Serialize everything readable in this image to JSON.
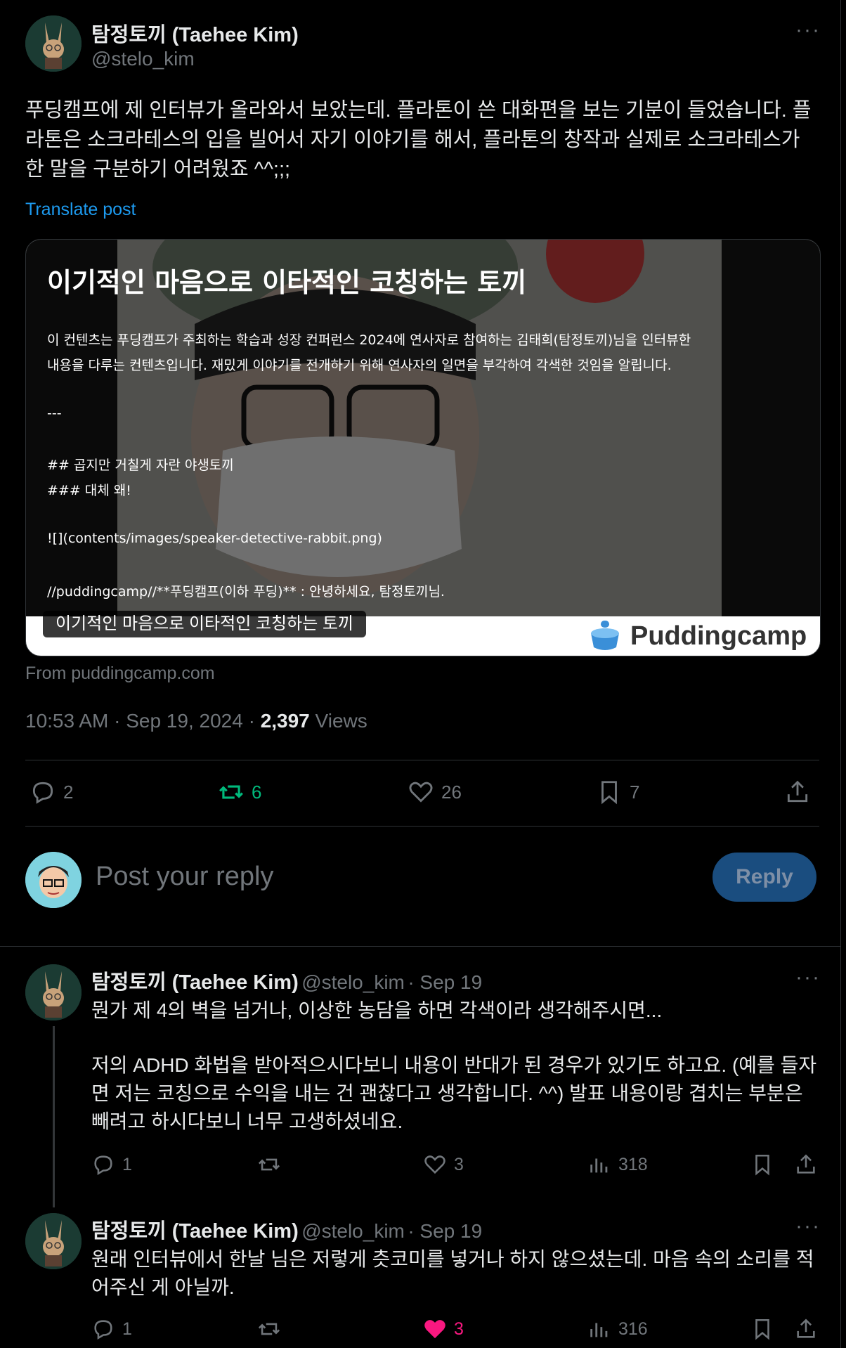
{
  "main_post": {
    "author_name": "탐정토끼 (Taehee Kim)",
    "author_handle": "@stelo_kim",
    "text": "푸딩캠프에 제 인터뷰가 올라와서 보았는데. 플라톤이 쓴 대화편을 보는 기분이 들었습니다. 플라톤은 소크라테스의 입을 빌어서 자기 이야기를 해서, 플라톤의 창작과 실제로 소크라테스가 한 말을 구분하기 어려웠죠 ^^;;;",
    "translate_label": "Translate post",
    "card": {
      "title": "이기적인 마음으로 이타적인 코칭하는 토끼",
      "body_line1": "이 컨텐츠는 푸딩캠프가 주최하는 학습과 성장 컨퍼런스 2024에 연사자로 참여하는 김태희(탐정토끼)님을 인터뷰한",
      "body_line2": "내용을 다루는 컨텐츠입니다. 재밌게 이야기를 전개하기 위해 연사자의 일면을 부각하여 각색한 것임을 알립니다.",
      "hr": "---",
      "h2": "## 곱지만 거칠게 자란 야생토끼",
      "h3": "### 대체 왜!",
      "img_md": "![](contents/images/speaker-detective-rabbit.png)",
      "last_line": "//puddingcamp//**푸딩캠프(이하 푸딩)** : 안녕하세요, 탐정토끼님.",
      "pill_label": "이기적인 마음으로 이타적인 코칭하는 토끼",
      "brand": "Puddingcamp"
    },
    "from_label": "From puddingcamp.com",
    "time": "10:53 AM",
    "date": "Sep 19, 2024",
    "views_count": "2,397",
    "views_label": "Views",
    "actions": {
      "replies": "2",
      "reposts": "6",
      "likes": "26",
      "bookmarks": "7"
    }
  },
  "composer": {
    "placeholder": "Post your reply",
    "button_label": "Reply"
  },
  "replies": [
    {
      "author_name": "탐정토끼 (Taehee Kim)",
      "author_handle": "@stelo_kim",
      "date": "· Sep 19",
      "line1": "뭔가 제 4의 벽을 넘거나, 이상한 농담을 하면 각색이라 생각해주시면...",
      "para2": "저의 ADHD 화법을 받아적으시다보니 내용이 반대가 된 경우가 있기도 하고요. (예를 들자면 저는 코칭으로 수익을 내는 건 괜찮다고 생각합니다. ^^) 발표 내용이랑 겹치는 부분은 빼려고 하시다보니 너무 고생하셨네요.",
      "replies": "1",
      "reposts": "",
      "likes": "3",
      "views": "318"
    },
    {
      "author_name": "탐정토끼 (Taehee Kim)",
      "author_handle": "@stelo_kim",
      "date": "· Sep 19",
      "line1": "원래 인터뷰에서 한날 님은 저렇게 츳코미를 넣거나 하지 않으셨는데. 마음 속의 소리를 적어주신 게 아닐까.",
      "replies": "1",
      "reposts": "",
      "likes": "3",
      "views": "316"
    }
  ],
  "colors": {
    "background": "#000000",
    "text": "#e7e9ea",
    "muted": "#71767b",
    "link": "#1d9bf0",
    "repost_green": "#00ba7c",
    "like_pink": "#f91880",
    "reply_button": "#1a4d7f"
  },
  "icons": [
    "more-icon",
    "reply-icon",
    "repost-icon",
    "like-icon",
    "bookmark-icon",
    "share-icon",
    "views-icon",
    "pudding-logo-icon"
  ]
}
